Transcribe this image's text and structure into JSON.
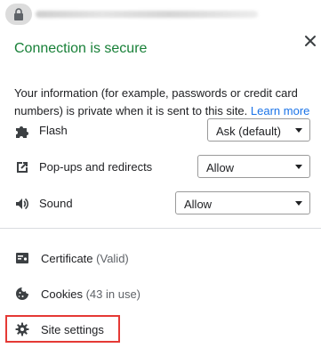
{
  "address_bar": {
    "lock_icon": "lock-icon"
  },
  "popup": {
    "title": "Connection is secure",
    "description_line1": "Your information (for example, passwords or credit card",
    "description_line2": "numbers) is private when it is sent to this site.",
    "learn_more": "Learn more",
    "close_icon": "close-icon",
    "title_color": "#188038",
    "link_color": "#1a73e8"
  },
  "permissions": [
    {
      "label": "Flash",
      "icon": "puzzle-icon",
      "value": "Ask (default)"
    },
    {
      "label": "Pop-ups and redirects",
      "icon": "popup-external-icon",
      "value": "Allow"
    },
    {
      "label": "Sound",
      "icon": "speaker-icon",
      "value": "Allow"
    }
  ],
  "items": [
    {
      "label": "Certificate",
      "sub": "(Valid)",
      "icon": "certificate-icon"
    },
    {
      "label": "Cookies",
      "sub": "(43 in use)",
      "icon": "cookie-icon"
    },
    {
      "label": "Site settings",
      "sub": "",
      "icon": "gear-icon"
    }
  ],
  "highlight_color": "#e53935"
}
